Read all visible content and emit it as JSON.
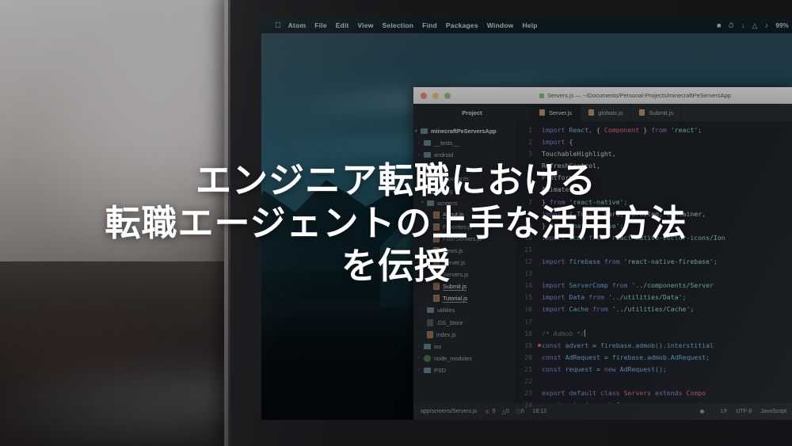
{
  "overlay": {
    "lines": [
      "エンジニア転職における",
      "転職エージェントの上手な活用方法",
      "を伝授"
    ]
  },
  "menubar": {
    "apple_icon": "apple-icon",
    "items": [
      "Atom",
      "File",
      "Edit",
      "View",
      "Selection",
      "Find",
      "Packages",
      "Window",
      "Help"
    ],
    "status_icons": [
      "camera-icon",
      "timemachine-icon",
      "download-icon",
      "wifi-icon",
      "volume-icon"
    ],
    "battery": "99%"
  },
  "editor": {
    "window_title": "Servers.js — ~/Documents/Personal-Projects/minecraftPeServersApp",
    "project_label": "Project",
    "tabs": [
      {
        "label": "Server.js"
      },
      {
        "label": "globals.js"
      },
      {
        "label": "Submit.js"
      }
    ],
    "tree": [
      {
        "name": "minecraftPeServersApp",
        "type": "root",
        "arrow": "▾"
      },
      {
        "name": "__tests__",
        "type": "folder",
        "arrow": "›"
      },
      {
        "name": "android",
        "type": "folder",
        "arrow": "›"
      },
      {
        "name": "app",
        "type": "folder",
        "arrow": "▾"
      },
      {
        "name": "components",
        "type": "folder",
        "arrow": "›"
      },
      {
        "name": "config",
        "type": "folder",
        "arrow": "›"
      },
      {
        "name": "screens",
        "type": "folder",
        "arrow": "▾"
      },
      {
        "name": "About.js",
        "type": "js",
        "arrow": "·",
        "selected": true
      },
      {
        "name": "Favorites.js",
        "type": "js",
        "arrow": "·"
      },
      {
        "name": "FilterServers.js",
        "type": "js",
        "arrow": "·"
      },
      {
        "name": "News.js",
        "type": "js",
        "arrow": "·"
      },
      {
        "name": "Server.js",
        "type": "js",
        "arrow": "·"
      },
      {
        "name": "Servers.js",
        "type": "js",
        "arrow": "·"
      },
      {
        "name": "Submit.js",
        "type": "js",
        "arrow": "·",
        "selected": true
      },
      {
        "name": "Tutorial.js",
        "type": "js",
        "arrow": "·",
        "selected": true
      },
      {
        "name": "utilities",
        "type": "folder",
        "arrow": "›"
      },
      {
        "name": ".DS_Store",
        "type": "generic",
        "arrow": "·"
      },
      {
        "name": "index.js",
        "type": "js",
        "arrow": "·"
      },
      {
        "name": "ios",
        "type": "folder",
        "arrow": "›"
      },
      {
        "name": "node_modules",
        "type": "node",
        "arrow": "›"
      },
      {
        "name": "PSD",
        "type": "folder",
        "arrow": "›"
      }
    ],
    "gutter": [
      "1",
      "2",
      "3",
      "4",
      "5",
      "6",
      "7",
      "8",
      "9",
      "10",
      "11",
      "12",
      "13",
      "14",
      "15",
      "16",
      "17",
      "18",
      "19",
      "20",
      "21",
      "22",
      "23",
      "24"
    ],
    "code_lines": [
      "import React, { Component } from 'react';",
      "import {",
      "    TouchableHighlight,",
      "    RefreshControl,",
      "    Platform,",
      "    Animate",
      "} from 'react-native';",
      "import { Toast, Card, CardItem, Container,",
      "} from 'native-base';",
      "import Icon from 'react-native-vector-icons/Ion",
      "",
      "import firebase from 'react-native-firebase';",
      "",
      "import ServerComp from '../components/Server",
      "import Data from '../utilities/Data';",
      "import Cache from '../utilities/Cache';",
      "",
      "/* Admob */",
      "const advert = firebase.admob().interstitial",
      "const AdRequest = firebase.admob.AdRequest;",
      "const request = new AdRequest();",
      "",
      "export default class Servers extends Compo",
      "    constructor(props) {"
    ],
    "status": {
      "file_path": "app/screens/Servers.js",
      "error_count": "9",
      "warning_count": "0",
      "info_count": "0",
      "cursor_position": "18:12",
      "line_ending": "LF",
      "encoding": "UTF-8",
      "grammar": "JavaScript"
    }
  },
  "colors": {
    "accent": "#9d7fd6",
    "string": "#8fd6c0",
    "error": "#cf7066",
    "overlay_text": "#ffffff"
  }
}
